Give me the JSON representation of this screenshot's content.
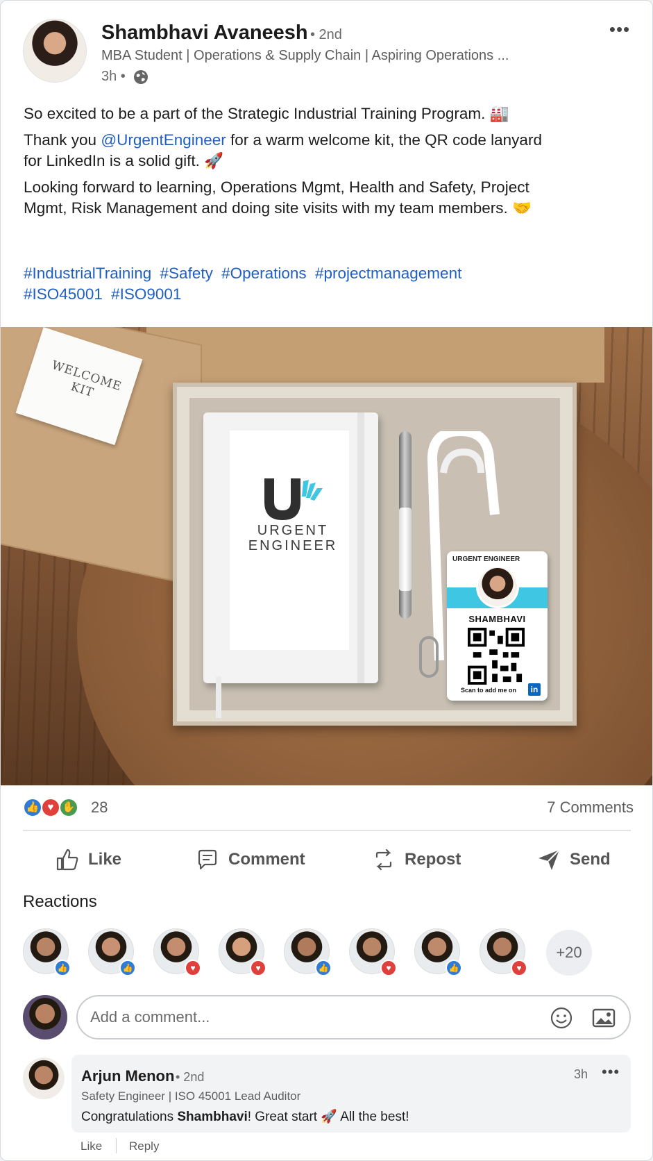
{
  "post": {
    "author_name": "Shambhavi Avaneesh",
    "degree": "• 2nd",
    "headline": "MBA Student | Operations & Supply Chain | Aspiring Operations ...",
    "time": "3h •",
    "more_icon": "more-horizontal-icon",
    "paragraph1": "So excited to be a part of the Strategic Industrial Training Program. 🏭",
    "paragraph2_before": "Thank you ",
    "mention": "@UrgentEngineer",
    "paragraph2_after": " for a warm welcome kit, the QR code lanyard for LinkedIn is a solid gift. 🚀",
    "paragraph3": "Looking forward to learning, Operations Mgmt, Health and Safety, Project Mgmt, Risk Management and doing site visits with my team members. 🤝",
    "hashtags": [
      "#IndustrialTraining",
      "#Safety",
      "#Operations",
      "#projectmanagement",
      "#ISO45001",
      "#ISO9001"
    ]
  },
  "media": {
    "welcome_card": "WELCOME KIT",
    "logo_text": "URGENT ENGINEER",
    "badge_logo": "URGENT ENGINEER",
    "badge_name": "SHAMBHAVI",
    "badge_scan": "Scan to add me on",
    "badge_in": "in"
  },
  "social": {
    "reaction_count": "28",
    "comment_count": "7 Comments",
    "reaction_types": [
      "like",
      "love",
      "support"
    ]
  },
  "actions": {
    "like": "Like",
    "comment": "Comment",
    "repost": "Repost",
    "send": "Send"
  },
  "reactions": {
    "title": "Reactions",
    "people": [
      {
        "reaction": "like",
        "skin": "#b78566"
      },
      {
        "reaction": "like",
        "skin": "#c99173"
      },
      {
        "reaction": "love",
        "skin": "#c48d6f"
      },
      {
        "reaction": "love",
        "skin": "#d6a07c"
      },
      {
        "reaction": "like",
        "skin": "#b07b5c"
      },
      {
        "reaction": "love",
        "skin": "#b98567"
      },
      {
        "reaction": "like",
        "skin": "#bf8a6b"
      },
      {
        "reaction": "love",
        "skin": "#b58162"
      }
    ],
    "more": "+20"
  },
  "add_comment": {
    "placeholder": "Add a comment..."
  },
  "comment": {
    "name": "Arjun Menon",
    "degree": "• 2nd",
    "headline": "Safety Engineer | ISO 45001 Lead Auditor",
    "text_before": "Congratulations ",
    "text_bold": "Shambhavi",
    "text_after": "! Great start 🚀 All the best!",
    "time": "3h",
    "like": "Like",
    "reply": "Reply"
  },
  "colors": {
    "link": "#1f5fc2",
    "like": "#2f7bd6",
    "love": "#e0403c",
    "support": "#4a9a4f",
    "badge_stripe": "#3ec6e2"
  }
}
